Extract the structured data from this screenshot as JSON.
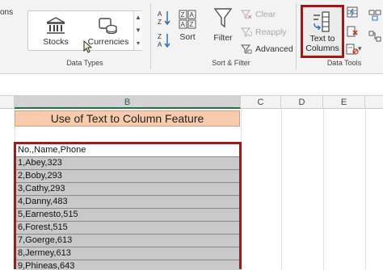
{
  "ribbon": {
    "left_edge_text": "ons",
    "data_types": {
      "group_label": "Data Types",
      "stocks_label": "Stocks",
      "currencies_label": "Currencies"
    },
    "sort_filter": {
      "group_label": "Sort & Filter",
      "sort_label": "Sort",
      "filter_label": "Filter",
      "clear_label": "Clear",
      "reapply_label": "Reapply",
      "advanced_label": "Advanced"
    },
    "data_tools": {
      "group_label": "Data Tools",
      "text_to_columns_line1": "Text to",
      "text_to_columns_line2": "Columns"
    }
  },
  "sheet": {
    "columns": [
      "B",
      "C",
      "D",
      "E"
    ],
    "title_cell": "Use of Text to Column Feature",
    "rows": [
      "No.,Name,Phone",
      "1,Abey,323",
      "2,Boby,293",
      "3,Cathy,293",
      "4,Danny,483",
      "5,Earnesto,515",
      "6,Forest,515",
      "7,Goerge,613",
      "8,Jermey,613",
      "9,Phineas,643"
    ]
  },
  "colors": {
    "highlight_border": "#a4161a",
    "title_fill": "#f8cbad",
    "data_fill": "#c9c9c9",
    "excel_green": "#217346"
  }
}
